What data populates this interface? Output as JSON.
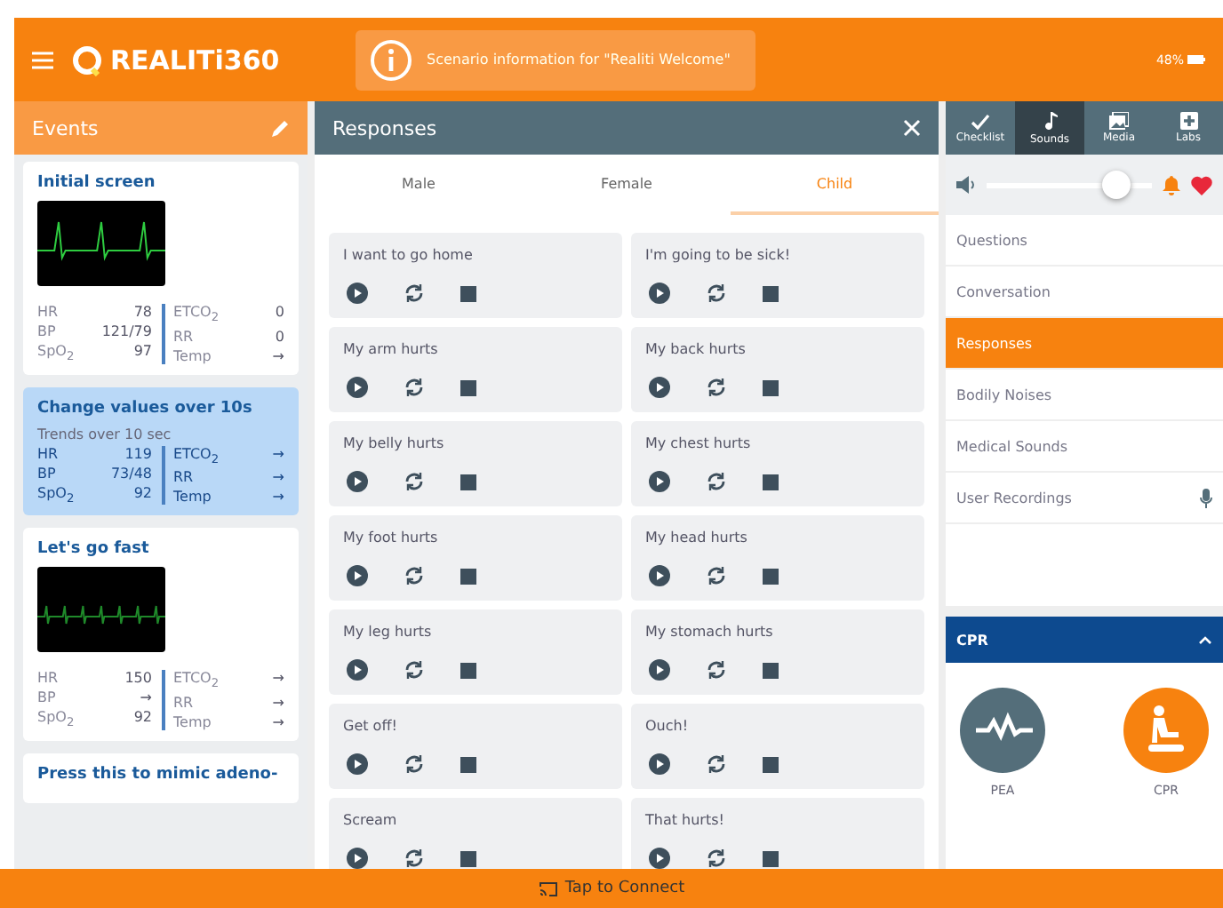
{
  "header": {
    "logo": "REALITi360",
    "scenario": "Scenario information for  \"Realiti Welcome\"",
    "battery": "48%"
  },
  "events": {
    "title": "Events",
    "items": [
      {
        "title": "Initial screen",
        "kind": "monitor",
        "selected": false,
        "left": [
          {
            "label": "HR",
            "value": "78"
          },
          {
            "label": "BP",
            "value": "121/79"
          },
          {
            "label": "SpO$_{2}$",
            "value": "97"
          }
        ],
        "right": [
          {
            "label": "ETCO$_{2}$",
            "value": "0"
          },
          {
            "label": "RR",
            "value": "0"
          },
          {
            "label": "Temp",
            "value": "→"
          }
        ]
      },
      {
        "title": "Change values over 10s",
        "subtitle": "Trends over 10 sec",
        "kind": "trend",
        "selected": true,
        "left": [
          {
            "label": "HR",
            "value": "119"
          },
          {
            "label": "BP",
            "value": "73/48"
          },
          {
            "label": "SpO$_{2}$",
            "value": "92"
          }
        ],
        "right": [
          {
            "label": "ETCO$_{2}$",
            "value": "→"
          },
          {
            "label": "RR",
            "value": "→"
          },
          {
            "label": "Temp",
            "value": "→"
          }
        ]
      },
      {
        "title": "Let's go fast",
        "kind": "tachymonitor",
        "selected": false,
        "left": [
          {
            "label": "HR",
            "value": "150"
          },
          {
            "label": "BP",
            "value": "→"
          },
          {
            "label": "SpO$_{2}$",
            "value": "92"
          }
        ],
        "right": [
          {
            "label": "ETCO$_{2}$",
            "value": "→"
          },
          {
            "label": "RR",
            "value": "→"
          },
          {
            "label": "Temp",
            "value": "→"
          }
        ]
      },
      {
        "title": "Press this to mimic adeno-",
        "kind": "plain",
        "selected": false
      }
    ]
  },
  "responses": {
    "title": "Responses",
    "tabs": [
      {
        "label": "Male",
        "selected": false
      },
      {
        "label": "Female",
        "selected": false
      },
      {
        "label": "Child",
        "selected": true
      }
    ],
    "items": [
      "I want to go home",
      "I'm going to be sick!",
      "My arm hurts",
      "My back hurts",
      "My belly hurts",
      "My chest hurts",
      "My foot hurts",
      "My head hurts",
      "My leg hurts",
      "My stomach hurts",
      "Get off!",
      "Ouch!",
      "Scream",
      "That hurts!"
    ]
  },
  "side": {
    "tabs": [
      {
        "label": "Checklist",
        "kind": "check",
        "selected": false
      },
      {
        "label": "Sounds",
        "kind": "note",
        "selected": true
      },
      {
        "label": "Media",
        "kind": "media",
        "selected": false
      },
      {
        "label": "Labs",
        "kind": "plus",
        "selected": false
      }
    ],
    "volume": {
      "level": 0.85
    },
    "items": [
      {
        "label": "Questions",
        "kind": "plain",
        "selected": false
      },
      {
        "label": "Conversation",
        "kind": "plain",
        "selected": false
      },
      {
        "label": "Responses",
        "kind": "plain",
        "selected": true
      },
      {
        "label": "Bodily Noises",
        "kind": "plain",
        "selected": false
      },
      {
        "label": "Medical Sounds",
        "kind": "plain",
        "selected": false
      },
      {
        "label": "User Recordings",
        "kind": "recording",
        "selected": false
      }
    ],
    "cpr": {
      "title": "CPR",
      "expanded": true,
      "tiles": [
        {
          "label": "PEA",
          "kind": "pea",
          "color": "#546e7a"
        },
        {
          "label": "CPR",
          "kind": "cpr",
          "color": "#f7820f"
        }
      ]
    }
  },
  "footer": {
    "label": "Tap to Connect"
  }
}
